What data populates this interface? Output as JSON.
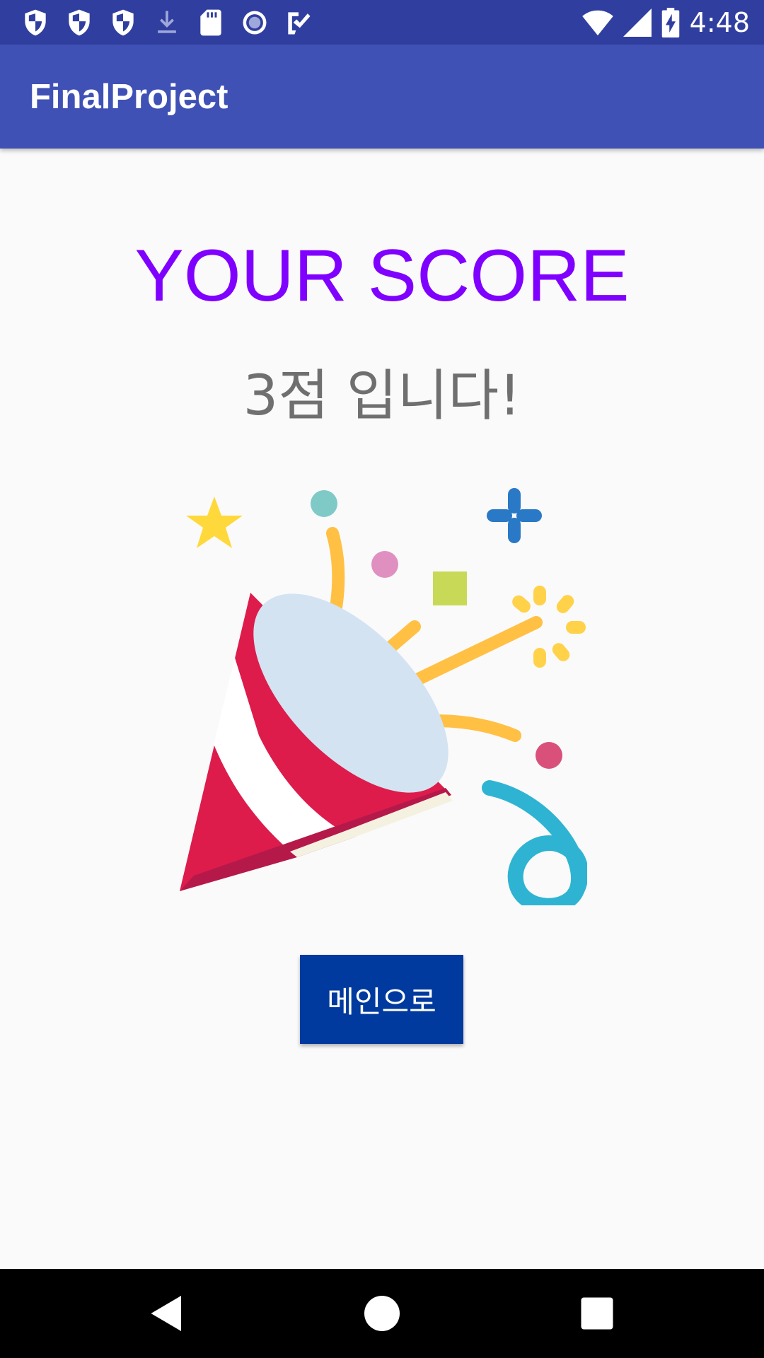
{
  "status_bar": {
    "time": "4:48",
    "left_icons": [
      "shield-icon",
      "shield-icon",
      "shield-icon",
      "download-icon",
      "sd-card-icon",
      "record-icon",
      "task-check-icon"
    ],
    "right_icons": [
      "wifi-icon",
      "cell-signal-icon",
      "battery-charging-icon"
    ],
    "color": "#303f9f"
  },
  "app_bar": {
    "title": "FinalProject",
    "color": "#3f51b5"
  },
  "content": {
    "heading": "YOUR SCORE",
    "heading_color": "#8000ff",
    "score_message": "3점 입니다!",
    "image_icon": "party-popper-icon",
    "button_label": "메인으로",
    "button_color": "#003a9e"
  },
  "nav_bar": {
    "icons": [
      "back-icon",
      "home-icon",
      "recents-icon"
    ]
  }
}
